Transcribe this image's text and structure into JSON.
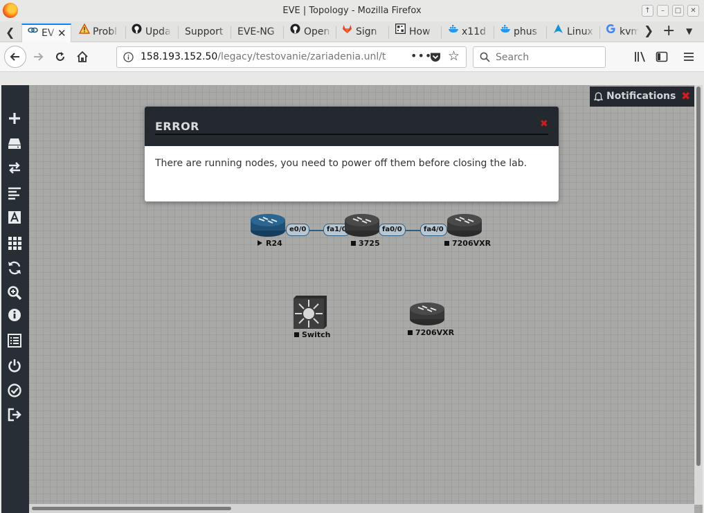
{
  "window": {
    "title": "EVE | Topology - Mozilla Firefox"
  },
  "tabs": [
    {
      "label": "EV",
      "icon": "eve-logo-icon",
      "active": true
    },
    {
      "label": "Probl",
      "icon": "warning-icon"
    },
    {
      "label": "Upda",
      "icon": "github-icon"
    },
    {
      "label": "Support",
      "icon": ""
    },
    {
      "label": "EVE-NG",
      "icon": ""
    },
    {
      "label": "Open",
      "icon": "github-icon"
    },
    {
      "label": "Sign",
      "icon": "gitlab-icon"
    },
    {
      "label": "How",
      "icon": "qr-icon"
    },
    {
      "label": "x11d",
      "icon": "docker-icon"
    },
    {
      "label": "phus",
      "icon": "docker-icon"
    },
    {
      "label": "Linux",
      "icon": "arch-icon"
    },
    {
      "label": "kvm",
      "icon": "google-icon"
    }
  ],
  "navbar": {
    "url_host": "158.193.152.50",
    "url_path": "/legacy/testovanie/zariadenia.unl/topol",
    "search_placeholder": "Search"
  },
  "notifications": {
    "label": "Notifications"
  },
  "sidebar_icons": [
    "add-icon",
    "node-icon",
    "connection-icon",
    "list-icon",
    "text-icon",
    "grid-icon",
    "refresh-icon",
    "zoom-icon",
    "info-icon",
    "config-list-icon",
    "power-icon",
    "check-icon",
    "logout-icon"
  ],
  "modal": {
    "title": "ERROR",
    "message": "There are running nodes, you need to power off them before closing the lab."
  },
  "topology": {
    "nodes": [
      {
        "name": "R24",
        "status": "running",
        "type": "router",
        "color": "#1f4f74"
      },
      {
        "name": "3725",
        "status": "stopped",
        "type": "router",
        "color": "#3c3c3c"
      },
      {
        "name": "7206VXR",
        "status": "stopped",
        "type": "router",
        "color": "#3c3c3c"
      },
      {
        "name": "Switch",
        "status": "stopped",
        "type": "switch",
        "color": "#3c3c3c"
      },
      {
        "name": "7206VXR",
        "status": "stopped",
        "type": "router",
        "color": "#3c3c3c"
      }
    ],
    "interfaces": [
      "e0/0",
      "fa1/0",
      "fa0/0",
      "fa4/0"
    ]
  }
}
